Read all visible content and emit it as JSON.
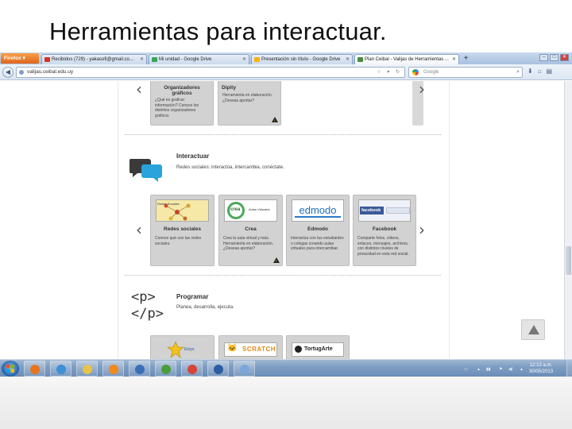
{
  "slide": {
    "title": "Herramientas para interactuar."
  },
  "browser": {
    "menu_button": "Firefox",
    "tabs": [
      {
        "label": "Recibidos (729) - yakasofi@gmail.co...",
        "active": false,
        "favicon_color": "#d93025"
      },
      {
        "label": "Mi unidad - Google Drive",
        "active": false,
        "favicon_color": "#34a853"
      },
      {
        "label": "Presentación sin título - Google Drive",
        "active": false,
        "favicon_color": "#f4b400"
      },
      {
        "label": "Plan Ceibal - Valijas de Herramientas ...",
        "active": true,
        "favicon_color": "#4a8a3c"
      }
    ],
    "url": "valijas.ceibal.edu.uy",
    "search_placeholder": "Google"
  },
  "page": {
    "top_cards": [
      {
        "title": "Organizadores gráficos",
        "desc": "¿Qué es graficar información? Conoce los distintos organizadores gráficos",
        "warn": false
      },
      {
        "title": "Dipity",
        "desc": "Herramienta en elaboración. ¿Deseas aportar?",
        "warn": true
      }
    ],
    "sections": [
      {
        "title": "Interactuar",
        "desc": "Redes sociales: interactúa, intercambia, conéctate.",
        "cards": [
          {
            "title": "Redes sociales",
            "desc": "Conoce qué son las redes sociales.",
            "thumb": "Redes Sociales",
            "warn": false
          },
          {
            "title": "Crea",
            "desc": "Crea tu aula virtual y más. Herramienta en elaboración. ¿Deseas aportar?",
            "thumb": "crea Aulas Virtuales",
            "warn": true
          },
          {
            "title": "Edmodo",
            "desc": "Interactúa con tus estudiantes o colegas creando aulas virtuales para intercambiar.",
            "thumb": "edmodo",
            "warn": false
          },
          {
            "title": "Facebook",
            "desc": "Comparte fotos, videos, enlaces, mensajes, archivos, con distintos niveles de privacidad en esta red social.",
            "thumb": "facebook",
            "warn": false
          }
        ]
      },
      {
        "title": "Programar",
        "desc": "Planea, desarrolla, ejecuta.",
        "icon_lines": [
          "<p>",
          "</p>"
        ],
        "cards": [
          {
            "thumb": "Etoys"
          },
          {
            "thumb": "SCRATCH"
          },
          {
            "thumb": "TortugArte"
          }
        ]
      }
    ]
  },
  "taskbar": {
    "apps": [
      {
        "name": "firefox",
        "color": "#e8741d"
      },
      {
        "name": "internet-explorer",
        "color": "#3d8fd8"
      },
      {
        "name": "file-explorer",
        "color": "#e8c34b"
      },
      {
        "name": "media-player",
        "color": "#f08a1a"
      },
      {
        "name": "hp-app",
        "color": "#3a6fb8"
      },
      {
        "name": "security-center",
        "color": "#4a9d3a"
      },
      {
        "name": "chrome",
        "color": "#d9443a"
      },
      {
        "name": "google-earth",
        "color": "#2a5ea0"
      },
      {
        "name": "paint",
        "color": "#7aa6d8"
      }
    ],
    "time": "12:12 a.m.",
    "date": "30/05/2013"
  }
}
